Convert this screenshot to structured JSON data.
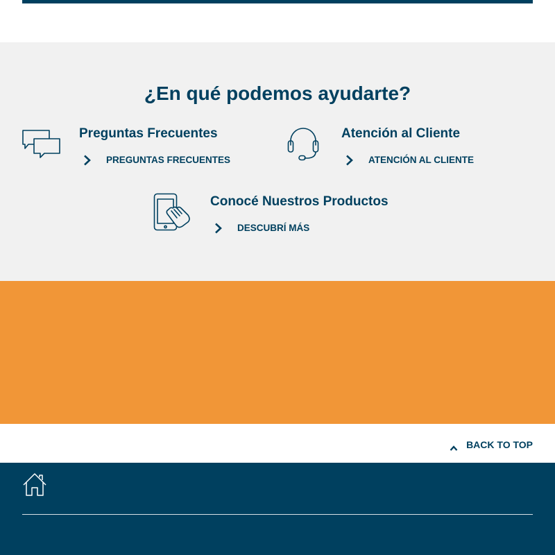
{
  "help": {
    "title": "¿En qué podemos ayudarte?",
    "cards": [
      {
        "icon": "chat-bubbles-icon",
        "title": "Preguntas Frecuentes",
        "link": "PREGUNTAS FRECUENTES"
      },
      {
        "icon": "headset-icon",
        "title": "Atención al Cliente",
        "link": "ATENCIÓN AL CLIENTE"
      },
      {
        "icon": "tablet-touch-icon",
        "title": "Conocé Nuestros Productos",
        "link": "DESCUBRÍ MÁS"
      }
    ]
  },
  "back_to_top": {
    "label": "BACK TO TOP",
    "icon": "chevron-up-icon"
  },
  "footer": {
    "icon": "home-icon"
  },
  "colors": {
    "primary": "#00405f",
    "help_background": "#f1f1f1",
    "orange_banner": "#f19637",
    "footer_background": "#00405f"
  }
}
